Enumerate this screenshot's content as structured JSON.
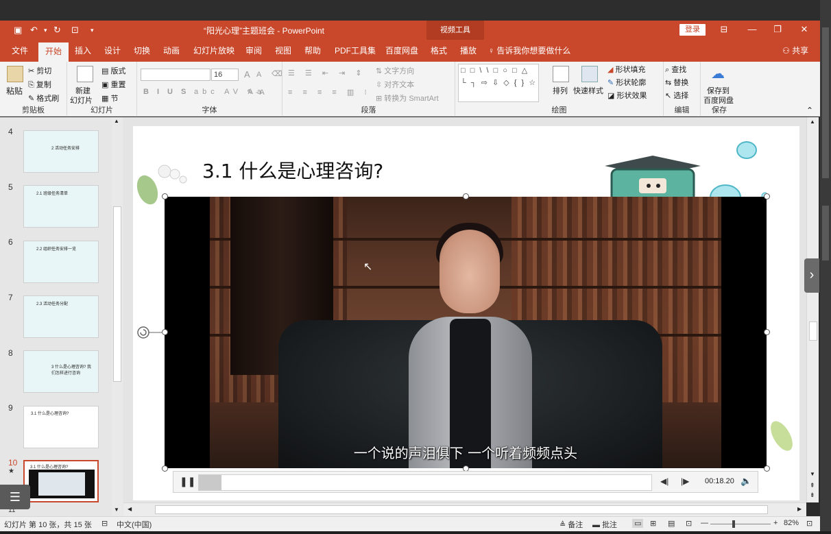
{
  "window": {
    "doc_title": "“阳光心理”主题班会 - PowerPoint",
    "context_tab": "视频工具",
    "login_label": "登录",
    "share_label": "共享",
    "tell_me": "告诉我你想要做什么"
  },
  "tabs": [
    "文件",
    "开始",
    "插入",
    "设计",
    "切换",
    "动画",
    "幻灯片放映",
    "审阅",
    "视图",
    "帮助",
    "PDF工具集",
    "百度网盘",
    "格式",
    "播放"
  ],
  "active_tab": "开始",
  "ribbon": {
    "clipboard": {
      "paste": "粘贴",
      "cut": "剪切",
      "copy": "复制",
      "format_painter": "格式刷",
      "label": "剪贴板"
    },
    "slides": {
      "new_slide_1": "新建",
      "new_slide_2": "幻灯片",
      "layout": "版式",
      "reset": "重置",
      "section": "节",
      "label": "幻灯片"
    },
    "font": {
      "size": "16",
      "grow": "A",
      "shrink": "A",
      "label": "字体"
    },
    "paragraph": {
      "text_direction": "文字方向",
      "align_text": "对齐文本",
      "smartart": "转换为 SmartArt",
      "label": "段落"
    },
    "drawing": {
      "shapes": "□ □ \\ \\ □ ○ □ △ └ ┐ ⇨ ⇩ ◇ { } ☆",
      "arrange": "排列",
      "quick_styles": "快速样式",
      "shape_fill": "形状填充",
      "shape_outline": "形状轮廓",
      "shape_effects": "形状效果",
      "label": "绘图"
    },
    "editing": {
      "find": "查找",
      "replace": "替换",
      "select": "选择",
      "label": "编辑"
    },
    "save": {
      "save_to_1": "保存到",
      "save_to_2": "百度网盘",
      "label": "保存"
    }
  },
  "thumbnails": [
    {
      "num": "4",
      "title": "2 活动任务安排"
    },
    {
      "num": "5",
      "title": "2.1 班级任务清单"
    },
    {
      "num": "6",
      "title": "2.2 组织任务安排一览"
    },
    {
      "num": "7",
      "title": "2.3 活动任务分配"
    },
    {
      "num": "8",
      "title": "3 什么是心理咨询? 我们怎样进行咨询"
    },
    {
      "num": "9",
      "title": "3.1 什么是心理咨询?"
    },
    {
      "num": "10",
      "title": "3.1 什么是心理咨询?"
    }
  ],
  "slide": {
    "title": "3.1 什么是心理咨询?",
    "subtitle": "一个说的声泪俱下 一个听着频频点头"
  },
  "media": {
    "time": "00:18.20",
    "progress": 0.05
  },
  "status": {
    "slide_info": "幻灯片 第 10 张，共 15 张",
    "language": "中文(中国)",
    "notes": "备注",
    "comments": "批注",
    "zoom": "82%"
  }
}
